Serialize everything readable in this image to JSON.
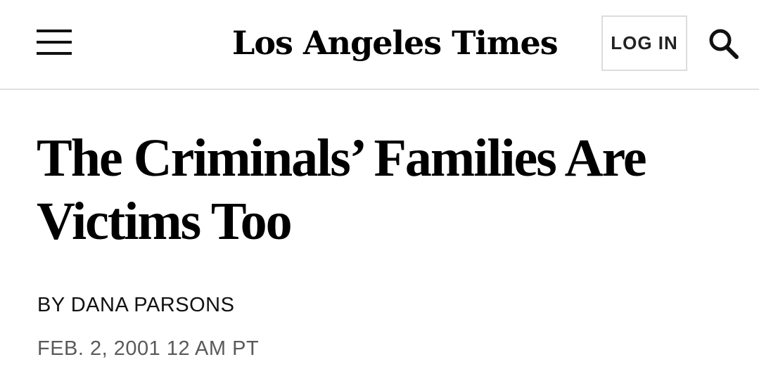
{
  "header": {
    "menu_icon": "hamburger-menu-icon",
    "logo_text": "Los Angeles Times",
    "login_label": "LOG IN",
    "search_icon": "search-icon"
  },
  "article": {
    "headline": "The Criminals’ Families Are Victims Too",
    "byline": "BY DANA PARSONS",
    "date": "FEB. 2, 2001 12 AM PT"
  },
  "colors": {
    "background": "#ffffff",
    "text": "#000000",
    "date_text": "#5a5a5a",
    "divider": "#e0e0e0"
  }
}
